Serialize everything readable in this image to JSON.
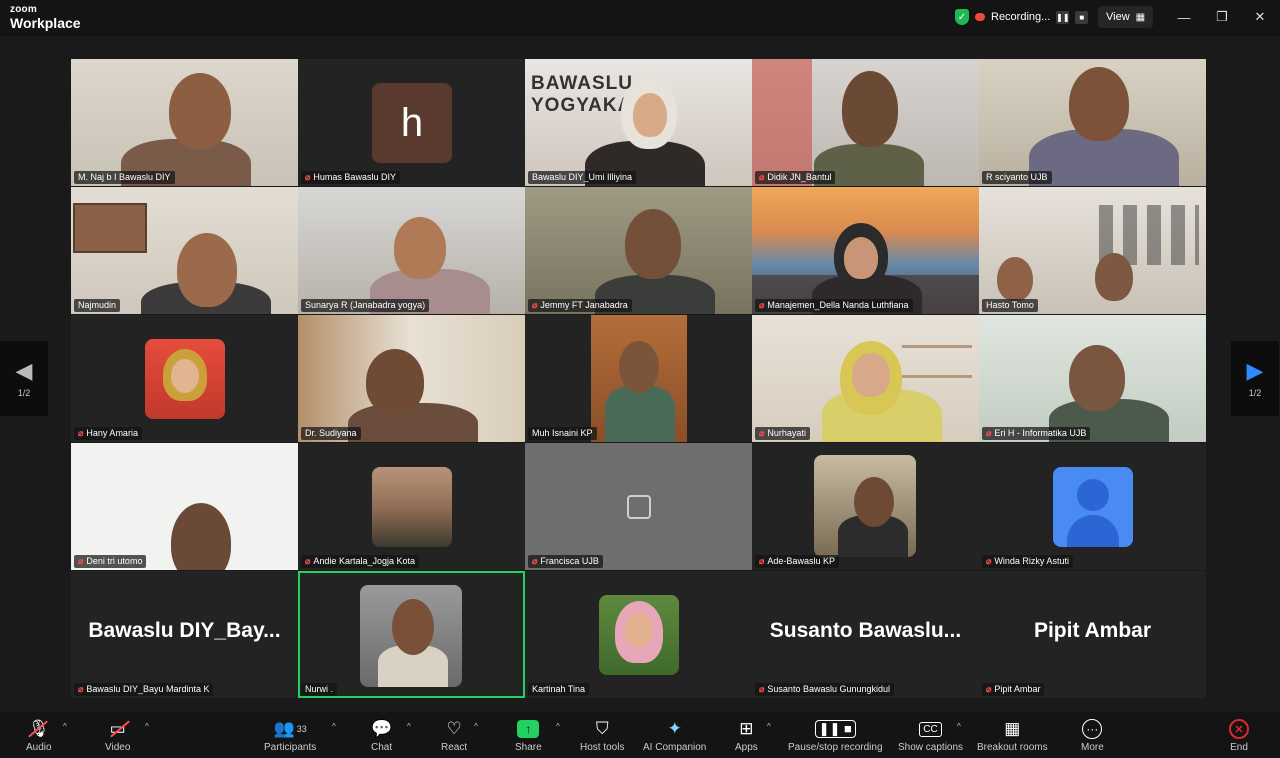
{
  "app": {
    "logo_line1": "zoom",
    "logo_line2": "Workplace"
  },
  "titlebar": {
    "recording_label": "Recording...",
    "view_label": "View",
    "colors": {
      "shield": "#1db954",
      "recording": "#e74c3c"
    }
  },
  "pager": {
    "prev_page": "1/2",
    "next_page": "1/2",
    "next_color": "#2d8cff"
  },
  "tiles": [
    {
      "name": "M. Naj b I Bawaslu DIY",
      "muted": false
    },
    {
      "name": "Humas Bawaslu DIY",
      "muted": true,
      "avatar_letter": "h"
    },
    {
      "name": "Bawaslu DIY_Umi Illiyina",
      "muted": false,
      "bg_text": "BAWASLU YOGYAKARTA"
    },
    {
      "name": "Didik JN_Bantul",
      "muted": true
    },
    {
      "name": "R sciyanto UJB",
      "muted": false
    },
    {
      "name": "Najmudin",
      "muted": false
    },
    {
      "name": "Sunarya R (Janabadra yogya)",
      "muted": false
    },
    {
      "name": "Jemmy FT Janabadra",
      "muted": true
    },
    {
      "name": "Manajemen_Della Nanda Luthfiana",
      "muted": true
    },
    {
      "name": "Hasto Tomo",
      "muted": false
    },
    {
      "name": "Hany Amaria",
      "muted": true
    },
    {
      "name": "Dr. Sudiyana",
      "muted": false
    },
    {
      "name": "Muh Isnaini KP",
      "muted": false
    },
    {
      "name": "Nurhayati",
      "muted": true
    },
    {
      "name": "Eri H - Informatika UJB",
      "muted": true
    },
    {
      "name": "Deni tri utomo",
      "muted": true
    },
    {
      "name": "Andie Kartala_Jogja Kota",
      "muted": true
    },
    {
      "name": "Francisca UJB",
      "muted": true
    },
    {
      "name": "Ade-Bawaslu KP",
      "muted": true
    },
    {
      "name": "Winda Rizky Astuti",
      "muted": true
    },
    {
      "name": "Bawaslu DIY_Bayu Mardinta K",
      "muted": true,
      "big_name": "Bawaslu  DIY_Bay..."
    },
    {
      "name": "Nurwi .",
      "muted": false
    },
    {
      "name": "Kartinah Tina",
      "muted": false
    },
    {
      "name": "Susanto Bawaslu Gunungkidul",
      "muted": true,
      "big_name": "Susanto  Bawaslu..."
    },
    {
      "name": "Pipit Ambar",
      "muted": true,
      "big_name": "Pipit Ambar"
    }
  ],
  "toolbar": {
    "audio": "Audio",
    "video": "Video",
    "participants": "Participants",
    "participants_count": "33",
    "chat": "Chat",
    "react": "React",
    "share": "Share",
    "host_tools": "Host tools",
    "ai_companion": "AI Companion",
    "apps": "Apps",
    "pause_stop": "Pause/stop recording",
    "captions": "Show captions",
    "breakout": "Breakout rooms",
    "more": "More",
    "end": "End",
    "colors": {
      "share": "#23d160",
      "end": "#e02828",
      "active_tile": "#23d160"
    }
  }
}
